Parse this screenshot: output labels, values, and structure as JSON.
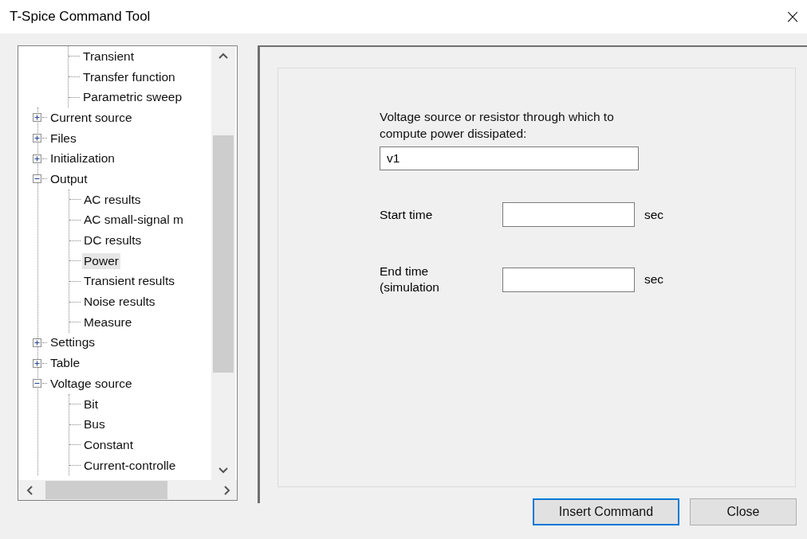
{
  "window": {
    "title": "T-Spice Command Tool",
    "close": "×"
  },
  "tree": {
    "continued_children": [
      {
        "label": "Transient",
        "selected": false
      },
      {
        "label": "Transfer function",
        "selected": false
      },
      {
        "label": "Parametric sweep",
        "selected": false
      }
    ],
    "nodes": [
      {
        "label": "Current source",
        "expanded": false,
        "selected": false
      },
      {
        "label": "Files",
        "expanded": false,
        "selected": false
      },
      {
        "label": "Initialization",
        "expanded": false,
        "selected": false
      },
      {
        "label": "Output",
        "expanded": true,
        "selected": false,
        "children": [
          {
            "label": "AC results",
            "selected": false
          },
          {
            "label": "AC small-signal m",
            "selected": false
          },
          {
            "label": "DC results",
            "selected": false
          },
          {
            "label": "Power",
            "selected": true
          },
          {
            "label": "Transient results",
            "selected": false
          },
          {
            "label": "Noise results",
            "selected": false
          },
          {
            "label": "Measure",
            "selected": false
          }
        ]
      },
      {
        "label": "Settings",
        "expanded": false,
        "selected": false
      },
      {
        "label": "Table",
        "expanded": false,
        "selected": false
      },
      {
        "label": "Voltage source",
        "expanded": true,
        "selected": false,
        "children": [
          {
            "label": "Bit",
            "selected": false
          },
          {
            "label": "Bus",
            "selected": false
          },
          {
            "label": "Constant",
            "selected": false
          },
          {
            "label": "Current-controlle",
            "selected": false
          }
        ]
      }
    ]
  },
  "form": {
    "source_label": "Voltage source or resistor through which to compute power dissipated:",
    "source_value": "v1",
    "fields": [
      {
        "label": "Start time",
        "unit": "sec"
      },
      {
        "label": "End time (simulation",
        "unit": "sec"
      }
    ]
  },
  "buttons": [
    {
      "label": "Insert Command",
      "default": true
    },
    {
      "label": "Close",
      "default": false
    }
  ]
}
